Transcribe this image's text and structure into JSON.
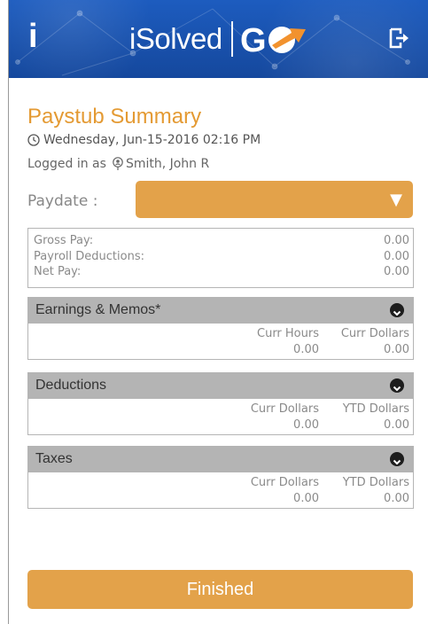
{
  "header": {
    "info_label": "i",
    "logo_text": "iSolved",
    "logo_badge": "GO",
    "accent_color": "#1a55b1"
  },
  "page": {
    "title": "Paystub Summary",
    "datetime": "Wednesday, Jun-15-2016 02:16 PM",
    "logged_in_prefix": "Logged in as",
    "user_name": "Smith, John R"
  },
  "paydate": {
    "label": "Paydate :",
    "selected": "",
    "color": "#e3a24a"
  },
  "summary": {
    "rows": [
      {
        "label": "Gross Pay:",
        "value": "0.00"
      },
      {
        "label": "Payroll Deductions:",
        "value": "0.00"
      },
      {
        "label": "Net Pay:",
        "value": "0.00"
      }
    ]
  },
  "sections": {
    "earnings": {
      "title": "Earnings & Memos*",
      "col1_header": "Curr Hours",
      "col1_value": "0.00",
      "col2_header": "Curr Dollars",
      "col2_value": "0.00"
    },
    "deductions": {
      "title": "Deductions",
      "col1_header": "Curr Dollars",
      "col1_value": "0.00",
      "col2_header": "YTD Dollars",
      "col2_value": "0.00"
    },
    "taxes": {
      "title": "Taxes",
      "col1_header": "Curr Dollars",
      "col1_value": "0.00",
      "col2_header": "YTD Dollars",
      "col2_value": "0.00"
    }
  },
  "footer": {
    "finish_label": "Finished"
  },
  "icons": {
    "clock": "clock-icon",
    "user": "user-pin-icon",
    "logout": "logout-icon",
    "dropdown": "caret-down-icon",
    "section_toggle": "chevron-down-circle-icon"
  }
}
